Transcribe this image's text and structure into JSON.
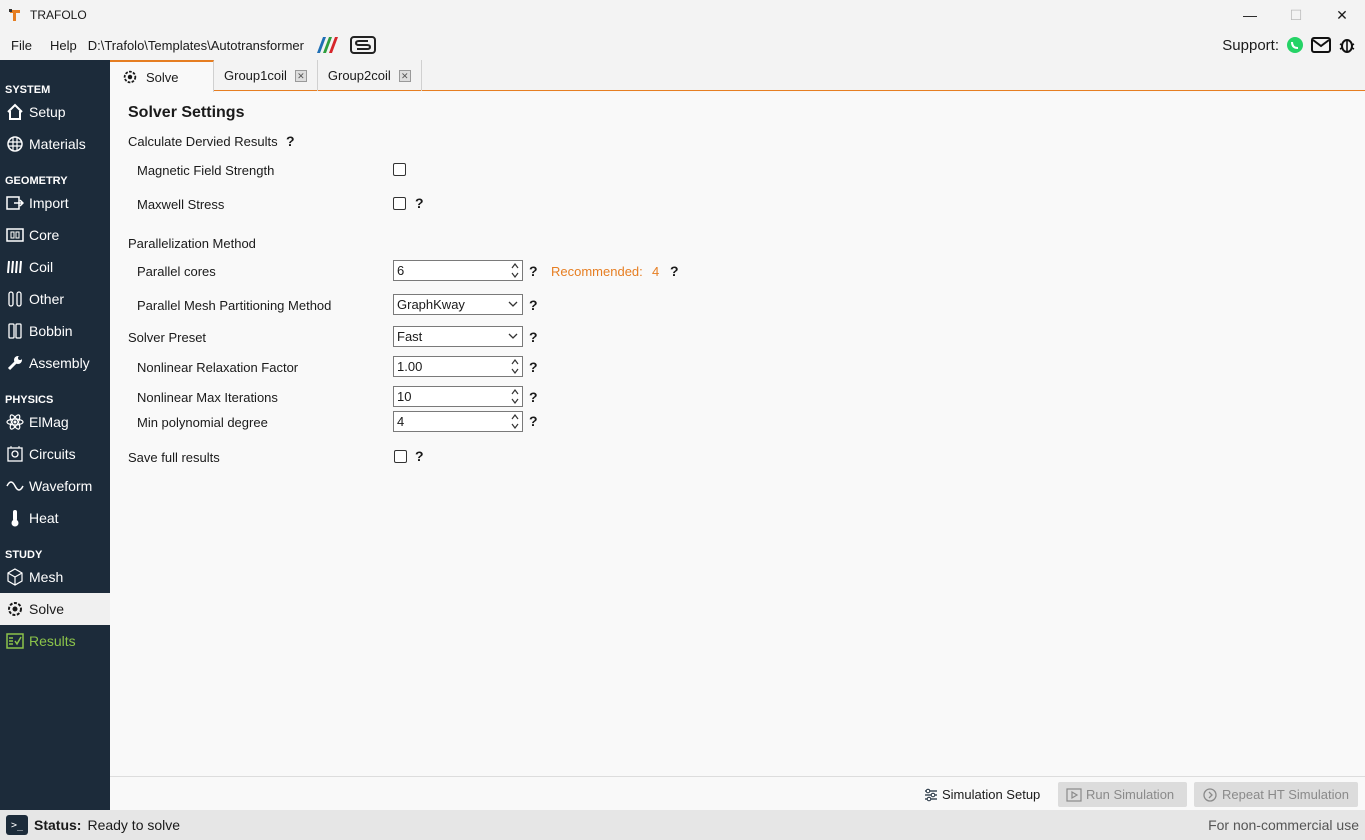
{
  "window": {
    "title": "TRAFOLO",
    "minimize": "—",
    "maximize": "☐",
    "close": "✕"
  },
  "menu": {
    "file": "File",
    "help": "Help",
    "path": "D:\\Trafolo\\Templates\\Autotransformer"
  },
  "support": {
    "label": "Support:"
  },
  "sidebar": {
    "system": "SYSTEM",
    "geometry": "GEOMETRY",
    "physics": "PHYSICS",
    "study": "STUDY",
    "items": {
      "setup": "Setup",
      "materials": "Materials",
      "import": "Import",
      "core": "Core",
      "coil": "Coil",
      "other": "Other",
      "bobbin": "Bobbin",
      "assembly": "Assembly",
      "elmag": "ElMag",
      "circuits": "Circuits",
      "waveform": "Waveform",
      "heat": "Heat",
      "mesh": "Mesh",
      "solve": "Solve",
      "results": "Results"
    }
  },
  "tabs": {
    "solve": "Solve",
    "group1": "Group1coil",
    "group2": "Group2coil",
    "close_glyph": "✕"
  },
  "solver": {
    "heading": "Solver Settings",
    "help_glyph": "?",
    "derived_results": "Calculate Dervied Results",
    "magnetic_field_strength": "Magnetic Field Strength",
    "maxwell_stress": "Maxwell Stress",
    "parallelization_method": "Parallelization Method",
    "parallel_cores": "Parallel cores",
    "parallel_cores_value": "6",
    "recommended_label": "Recommended:",
    "recommended_value": "4",
    "partitioning_method": "Parallel Mesh Partitioning Method",
    "partitioning_value": "GraphKway",
    "solver_preset": "Solver Preset",
    "solver_preset_value": "Fast",
    "relaxation_factor": "Nonlinear Relaxation Factor",
    "relaxation_value": "1.00",
    "max_iterations": "Nonlinear Max Iterations",
    "max_iterations_value": "10",
    "min_poly_degree": "Min polynomial degree",
    "min_poly_value": "4",
    "save_full_results": "Save full results"
  },
  "actions": {
    "simulation_setup": "Simulation Setup",
    "run_simulation": "Run Simulation",
    "repeat_ht": "Repeat HT Simulation"
  },
  "status": {
    "label": "Status:",
    "value": "Ready to solve",
    "license": "For non-commercial use",
    "term_glyph": ">_"
  },
  "colors": {
    "accent": "#e67e22",
    "sidebar_bg": "#1c2b3a",
    "results_green": "#8bc34a",
    "whatsapp": "#25d366"
  }
}
